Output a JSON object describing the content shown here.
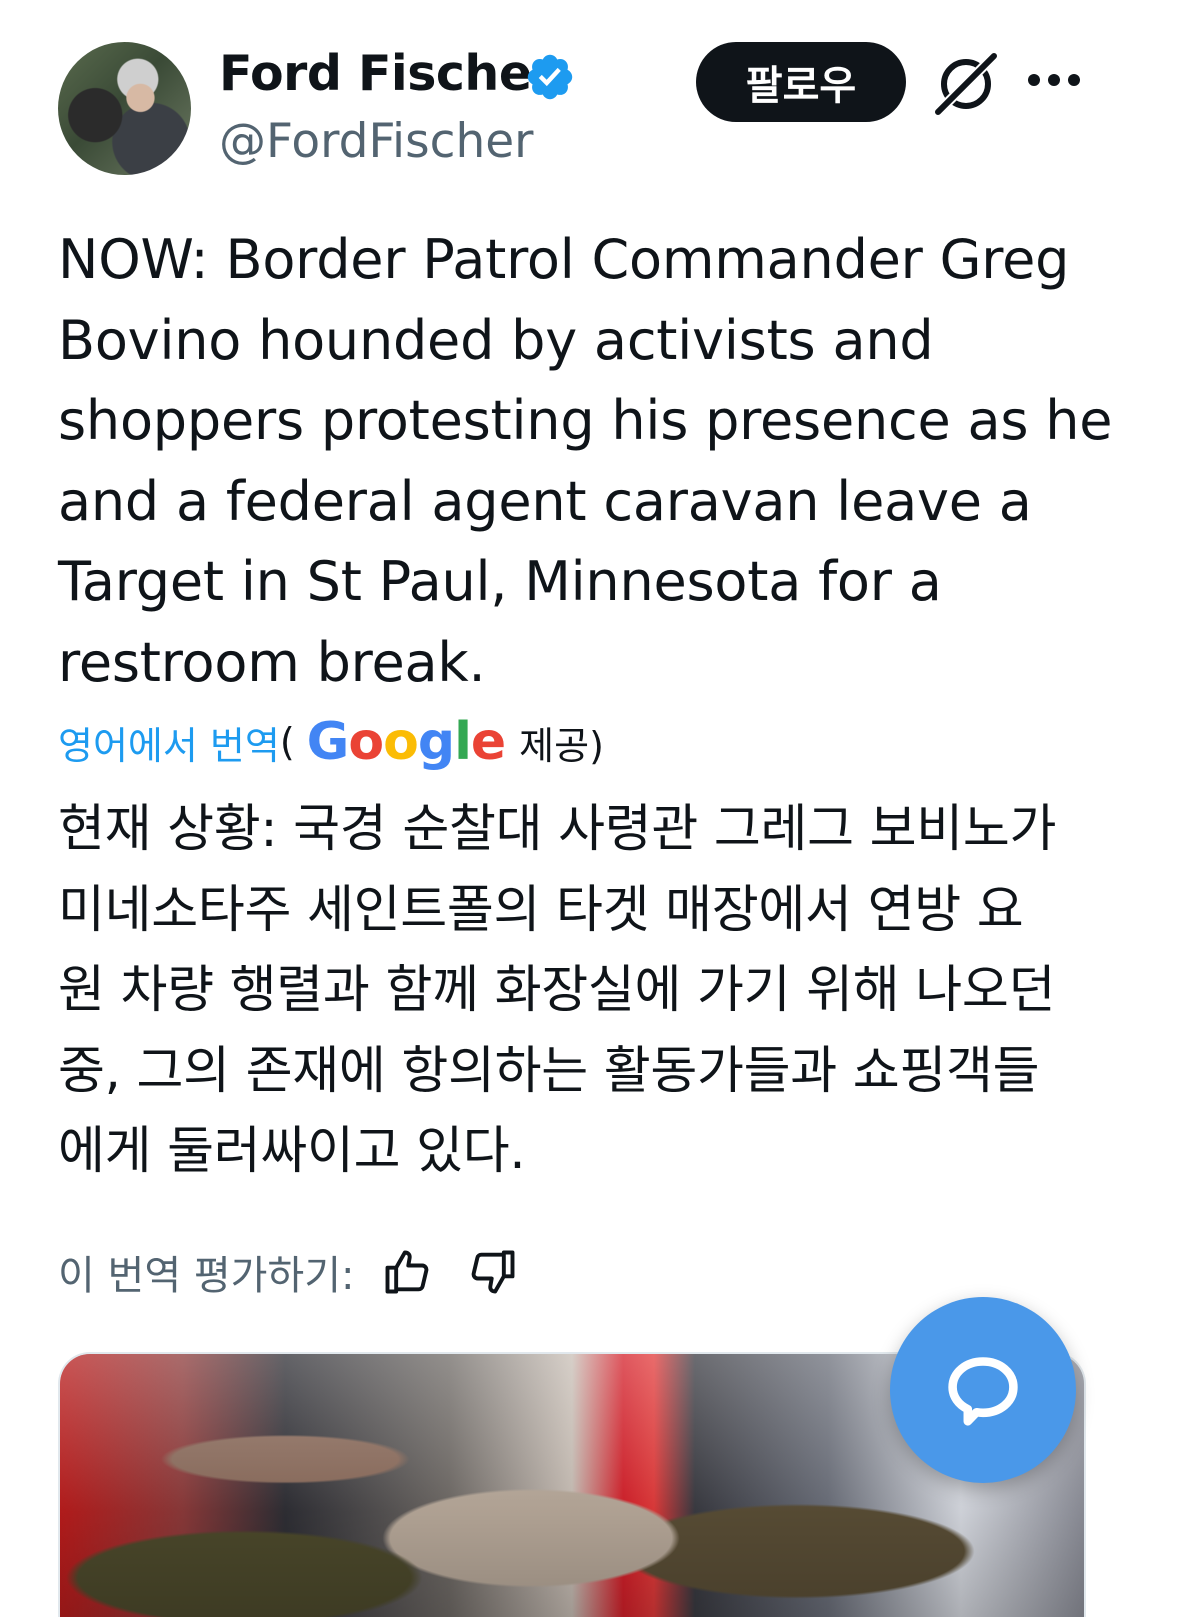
{
  "author": {
    "name": "Ford Fischer",
    "handle": "@FordFischer"
  },
  "actions": {
    "follow_label": "팔로우"
  },
  "tweet": {
    "text": "NOW: Border Patrol Commander Greg\nBovino hounded by activists and\nshoppers protesting his presence as he\nand a federal agent caravan leave a\nTarget in St Paul, Minnesota for a\nrestroom break."
  },
  "translation": {
    "link_label": "영어에서 번역",
    "open_paren": "(",
    "provider": "Google",
    "provided_label": "제공)",
    "text": "현재 상황: 국경 순찰대 사령관 그레그 보비노가\n미네소타주 세인트폴의 타겟 매장에서 연방 요\n원 차량 행렬과 함께 화장실에 가기 위해 나오던\n중, 그의 존재에 항의하는 활동가들과 쇼핑객들\n에게 둘러싸이고 있다.",
    "rate_label": "이 번역 평가하기:"
  },
  "icons": {
    "verified": "verified-badge-icon",
    "grok": "grok-icon",
    "more": "more-icon",
    "thumbs_up": "thumbs-up-icon",
    "thumbs_down": "thumbs-down-icon",
    "compose": "message-icon"
  },
  "colors": {
    "link": "#1d9bf0",
    "verified": "#1d9bf0",
    "follow_button": "#0f1419",
    "fab": "#4a98e9",
    "secondary_text": "#536471"
  }
}
